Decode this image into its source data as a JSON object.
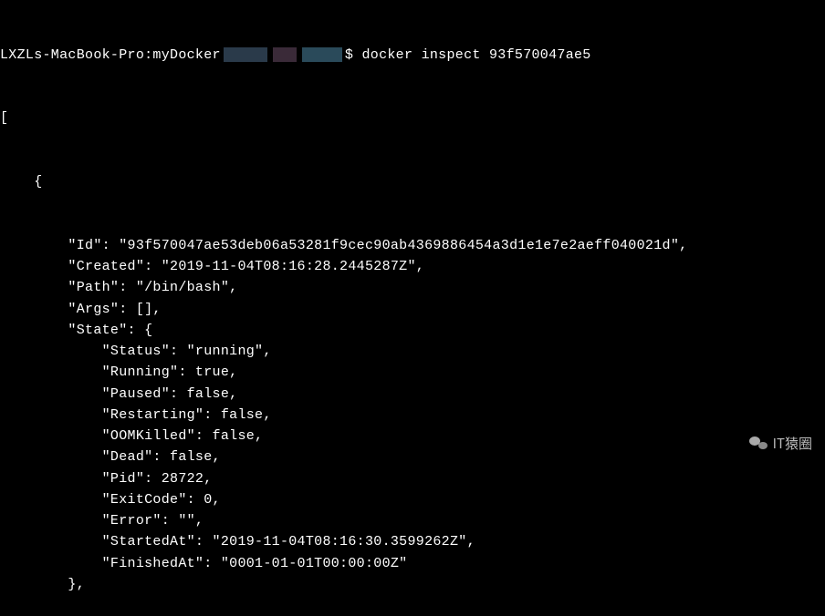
{
  "prompt": {
    "host": "LXZLs-MacBook-Pro:myDocker",
    "symbol": "$",
    "command": "docker inspect 93f570047ae5"
  },
  "output": {
    "open_bracket": "[",
    "open_brace": "    {",
    "lines": [
      "        \"Id\": \"93f570047ae53deb06a53281f9cec90ab4369886454a3d1e1e7e2aeff040021d\",",
      "        \"Created\": \"2019-11-04T08:16:28.2445287Z\",",
      "        \"Path\": \"/bin/bash\",",
      "        \"Args\": [],",
      "        \"State\": {",
      "            \"Status\": \"running\",",
      "            \"Running\": true,",
      "            \"Paused\": false,",
      "            \"Restarting\": false,",
      "            \"OOMKilled\": false,",
      "            \"Dead\": false,",
      "            \"Pid\": 28722,",
      "            \"ExitCode\": 0,",
      "            \"Error\": \"\",",
      "            \"StartedAt\": \"2019-11-04T08:16:30.3599262Z\",",
      "            \"FinishedAt\": \"0001-01-01T00:00:00Z\"",
      "        },"
    ]
  },
  "watermark": "IT猿圈"
}
